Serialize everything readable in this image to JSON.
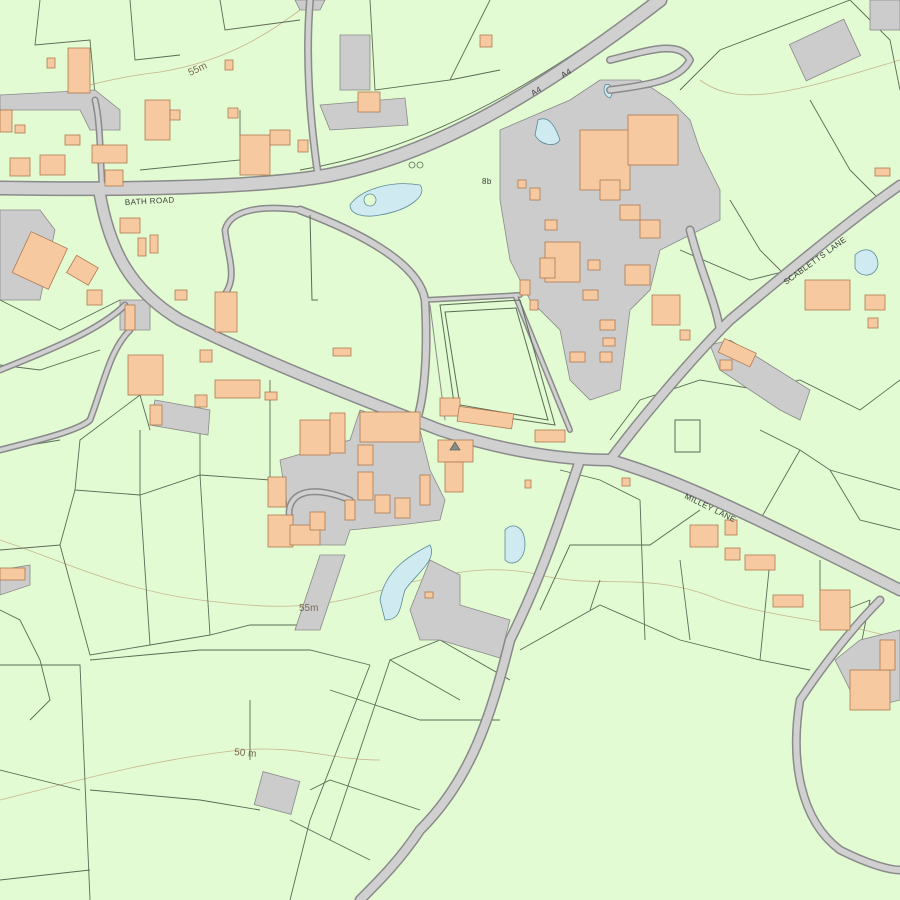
{
  "map": {
    "colors": {
      "land": "#e2fbd2",
      "road": "#cfcfcf",
      "road_edge": "#8a8a8a",
      "building": "#f7c9a0",
      "building_edge": "#b07a52",
      "paved": "#cccccc",
      "water": "#cfeaf0",
      "field_line": "#5b6b55",
      "contour": "#c8b58e"
    },
    "road_labels": {
      "bath_road": "BATH ROAD",
      "a4_1": "A4",
      "a4_2": "A4",
      "scabletts_lane": "SCABLETTS LANE",
      "milley_lane": "MILLEY LANE"
    },
    "contour_labels": {
      "c55_top": "55m",
      "c55_mid": "55m",
      "c50": "50 m"
    },
    "spot_labels": {
      "sign": "8b"
    }
  }
}
